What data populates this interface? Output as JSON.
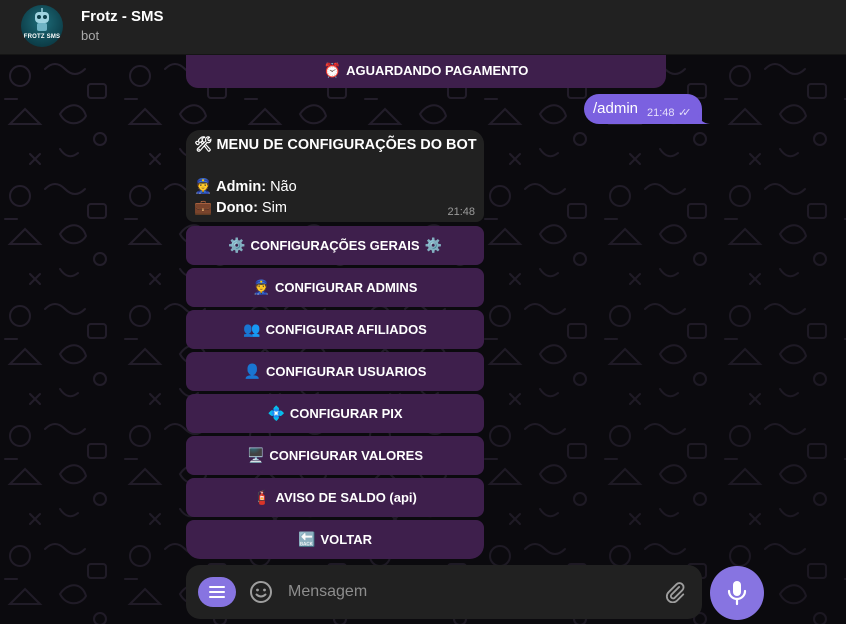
{
  "header": {
    "avatar_text": "FROTZ SMS",
    "title": "Frotz - SMS",
    "subtitle": "bot"
  },
  "pending_button": {
    "icon": "alarm-clock-icon",
    "emoji": "⏰",
    "label": "AGUARDANDO PAGAMENTO"
  },
  "outgoing_message": {
    "text": "/admin",
    "time": "21:48",
    "status": "read"
  },
  "incoming_message": {
    "title_emoji": "🛠",
    "title": "MENU DE CONFIGURAÇÕES DO BOT",
    "admin_emoji": "👮",
    "admin_label": "Admin:",
    "admin_value": "Não",
    "owner_emoji": "💼",
    "owner_label": "Dono:",
    "owner_value": "Sim",
    "time": "21:48"
  },
  "keyboard": [
    {
      "emoji": "⚙️",
      "label": "CONFIGURAÇÕES GERAIS",
      "emoji_after": "⚙️"
    },
    {
      "emoji": "👮",
      "label": "CONFIGURAR ADMINS"
    },
    {
      "emoji": "👥",
      "label": "CONFIGURAR AFILIADOS"
    },
    {
      "emoji": "👤",
      "label": "CONFIGURAR USUARIOS"
    },
    {
      "emoji": "💠",
      "label": "CONFIGURAR PIX"
    },
    {
      "emoji": "🖥️",
      "label": "CONFIGURAR VALORES"
    },
    {
      "emoji": "🧯",
      "label": "AVISO DE SALDO (api)"
    },
    {
      "emoji": "🔙",
      "label": "VOLTAR"
    }
  ],
  "composer": {
    "placeholder": "Mensagem"
  },
  "colors": {
    "accent": "#8774e1",
    "outgoing_bubble": "#7b61e0",
    "keyboard_button": "#3e1f4c",
    "incoming_bubble": "#212121",
    "header": "#212121"
  }
}
